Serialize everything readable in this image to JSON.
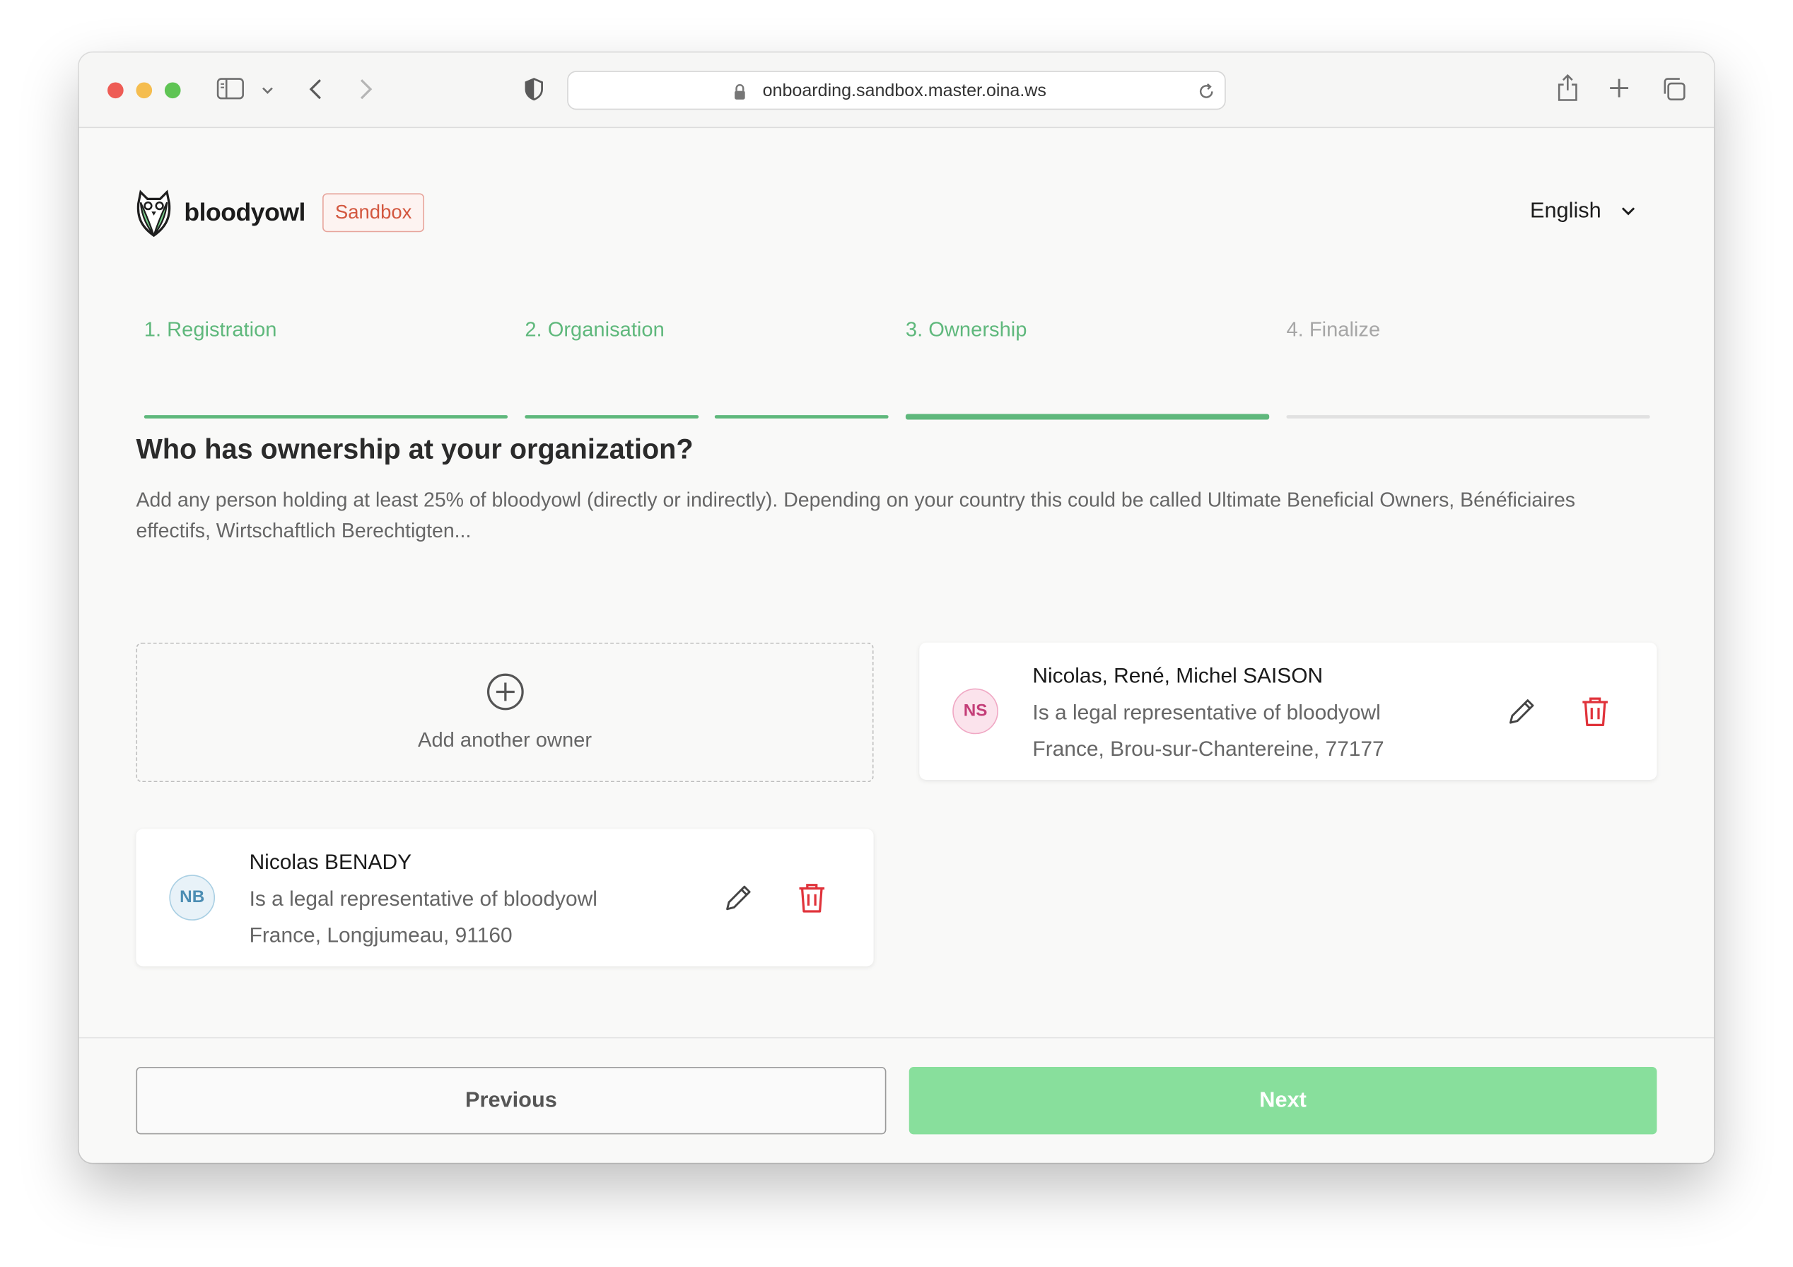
{
  "browser": {
    "url": "onboarding.sandbox.master.oina.ws"
  },
  "header": {
    "brand": "bloodyowl",
    "environment_badge": "Sandbox",
    "language": "English"
  },
  "steps": [
    {
      "label": "1. Registration",
      "state": "completed"
    },
    {
      "label": "2. Organisation",
      "state": "completed"
    },
    {
      "label": "3. Ownership",
      "state": "active"
    },
    {
      "label": "4. Finalize",
      "state": "upcoming"
    }
  ],
  "page": {
    "title": "Who has ownership at your organization?",
    "description": "Add any person holding at least 25% of bloodyowl (directly or indirectly). Depending on your country this could be called Ultimate Beneficial Owners, Bénéficiaires effectifs, Wirtschaftlich Berechtigten..."
  },
  "add_owner": {
    "label": "Add another owner"
  },
  "owners": [
    {
      "initials": "NS",
      "name": "Nicolas, René, Michel SAISON",
      "role": "Is a legal representative of bloodyowl",
      "address": "France, Brou-sur-Chantereine, 77177"
    },
    {
      "initials": "NB",
      "name": "Nicolas BENADY",
      "role": "Is a legal representative of bloodyowl",
      "address": "France, Longjumeau, 91160"
    }
  ],
  "footer": {
    "previous_label": "Previous",
    "next_label": "Next"
  },
  "colors": {
    "accent_green": "#5fb87c",
    "next_button": "#88df9c",
    "delete_red": "#e0333b",
    "sandbox_red": "#d3573f"
  }
}
